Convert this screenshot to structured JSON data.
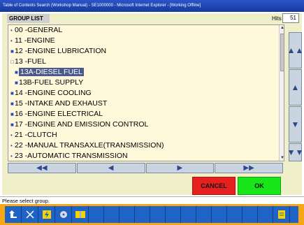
{
  "window": {
    "title": "Table of Contents Search (Workshop Manual) - SE1000000 - Microsoft Internet Explorer - [Working Offline]"
  },
  "header": {
    "group_list_label": "GROUP LIST",
    "hits_label": "Hits",
    "hits_value": "51"
  },
  "list": {
    "items": [
      {
        "label": "00 -GENERAL",
        "marker": "•",
        "indent": false,
        "selected": false
      },
      {
        "label": "11 -ENGINE",
        "marker": "•",
        "indent": false,
        "selected": false
      },
      {
        "label": "12 -ENGINE LUBRICATION",
        "marker": "■",
        "indent": false,
        "selected": false
      },
      {
        "label": "13 -FUEL",
        "marker": "□",
        "indent": false,
        "selected": false
      },
      {
        "label": "13A-DIESEL FUEL",
        "marker": "■",
        "indent": true,
        "selected": true
      },
      {
        "label": "13B-FUEL SUPPLY",
        "marker": "■",
        "indent": true,
        "selected": false
      },
      {
        "label": "14 -ENGINE COOLING",
        "marker": "■",
        "indent": false,
        "selected": false
      },
      {
        "label": "15 -INTAKE AND EXHAUST",
        "marker": "■",
        "indent": false,
        "selected": false
      },
      {
        "label": "16 -ENGINE ELECTRICAL",
        "marker": "■",
        "indent": false,
        "selected": false
      },
      {
        "label": "17 -ENGINE AND EMISSION CONTROL",
        "marker": "■",
        "indent": false,
        "selected": false
      },
      {
        "label": "21 -CLUTCH",
        "marker": "•",
        "indent": false,
        "selected": false
      },
      {
        "label": "22 -MANUAL TRANSAXLE(TRANSMISSION)",
        "marker": "•",
        "indent": false,
        "selected": false
      },
      {
        "label": "23 -AUTOMATIC TRANSMISSION",
        "marker": "•",
        "indent": false,
        "selected": false
      }
    ]
  },
  "side_buttons": [
    {
      "name": "scroll-top-button",
      "glyph": "▲▲"
    },
    {
      "name": "scroll-up-button",
      "glyph": "▲"
    },
    {
      "name": "scroll-down-button",
      "glyph": "▼"
    },
    {
      "name": "scroll-bottom-button",
      "glyph": "▼▼"
    }
  ],
  "nav_buttons": [
    {
      "name": "first-page-button",
      "glyph": "◀◀"
    },
    {
      "name": "prev-page-button",
      "glyph": "◀"
    },
    {
      "name": "next-page-button",
      "glyph": "▶"
    },
    {
      "name": "last-page-button",
      "glyph": "▶▶"
    }
  ],
  "actions": {
    "cancel_label": "CANCEL",
    "ok_label": "OK"
  },
  "status": {
    "message": "Please select group."
  },
  "toolbar": {
    "icons": [
      "home-up-icon",
      "tools-icon",
      "lightning-icon",
      "disc-icon",
      "book-icon",
      "blank",
      "blank",
      "blank",
      "blank",
      "blank",
      "blank",
      "blank",
      "blank",
      "blank",
      "blank",
      "blank",
      "blank",
      "page-icon"
    ]
  },
  "colors": {
    "title_bar": "#163b9e",
    "panel_bg": "#efefc9",
    "list_bg": "#fff8da",
    "selection": "#4b5a8c",
    "cancel": "#e61f1f",
    "ok": "#19e619",
    "toolbar_frame": "#f7a614",
    "toolbar_strip": "#1e63c5"
  }
}
